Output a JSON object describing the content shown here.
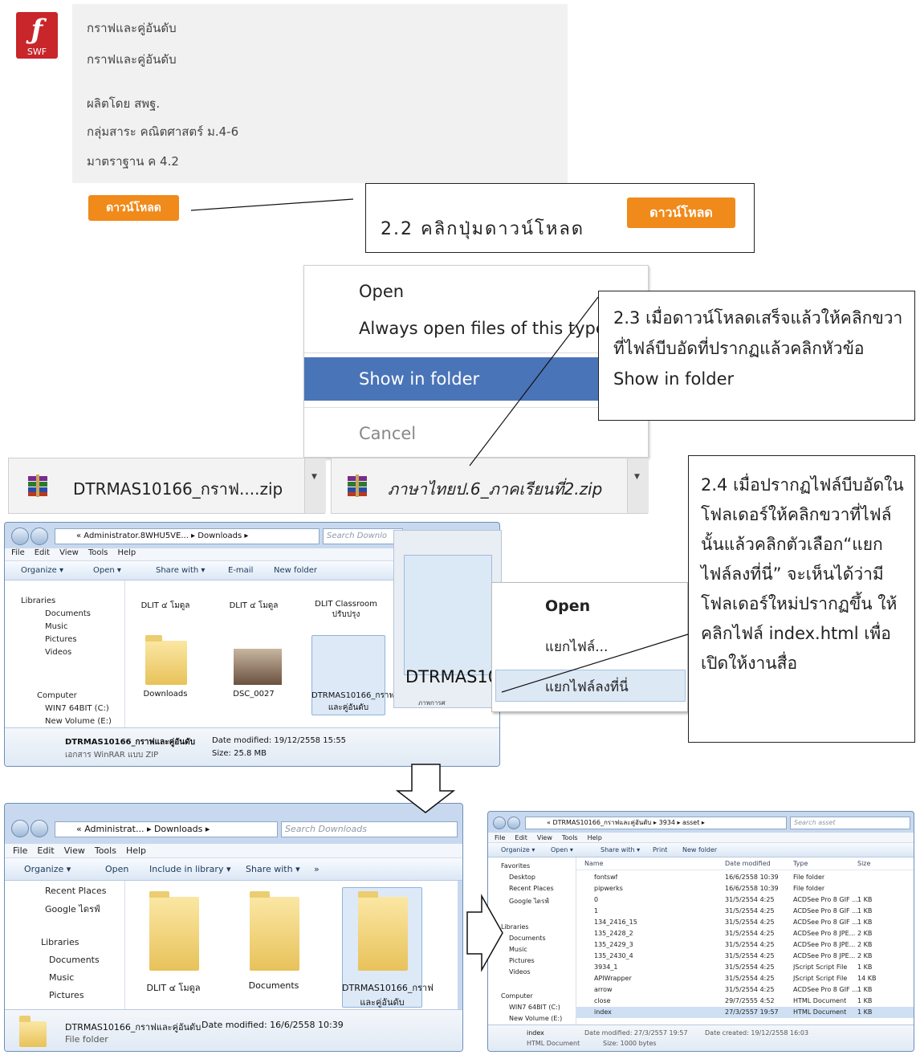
{
  "section1": {
    "icon_text": "SWF",
    "title": "กราฟและคู่อันดับ",
    "subtitle": "กราฟและคู่อันดับ",
    "producer": "ผลิตโดย สพฐ.",
    "subject": "กลุ่มสาระ คณิตศาสตร์ ม.4-6",
    "standard": "มาตราฐาน ค 4.2",
    "download_button": "ดาวน์โหลด",
    "callout_text": "2.2 คลิกปุ่มดาวน์โหลด",
    "callout_button": "ดาวน์โหลด"
  },
  "section2": {
    "menu_items": [
      "Open",
      "Always open files of this type",
      "Show in folder",
      "Cancel"
    ],
    "highlight_color": "#4a74b8",
    "callout_text": "2.3 เมื่อดาวน์โหลดเสร็จแล้วให้คลิกขวาที่ไฟล์บีบอัดที่ปรากฏแล้วคลิกหัวข้อ Show  in folder",
    "download1": "DTRMAS10166_กราฟ....zip",
    "download2": "ภาษาไทยป.6_ภาคเรียนที่2.zip"
  },
  "explorer1": {
    "address": "« Administrator.8WHU5VE... ▸ Downloads ▸",
    "search": "Search Downlo",
    "menubar": [
      "File",
      "Edit",
      "View",
      "Tools",
      "Help"
    ],
    "toolbar": [
      "Organize ▾",
      "Open ▾",
      "Share with ▾",
      "E-mail",
      "New folder"
    ],
    "nav": [
      "Libraries",
      "Documents",
      "Music",
      "Pictures",
      "Videos",
      "Computer",
      "WIN7 64BIT (C:)",
      "New Volume (E:)"
    ],
    "top_labels": [
      "DLIT ๔ โมดูล",
      "DLIT ๔ โมดูล",
      "DLIT Classroom ปรับปรุง"
    ],
    "items": [
      "Downloads",
      "DSC_0027",
      "DTRMAS10166_กราฟและคู่อันดับ"
    ],
    "details_name": "DTRMAS10166_กราฟและคู่อันดับ",
    "details_modified": "Date modified: 19/12/2558 15:55",
    "details_type": "เอกสาร WinRAR แบบ ZIP",
    "details_size": "Size: 25.8 MB"
  },
  "rar_popup": {
    "file_label": "DTRMAS10",
    "small_label": "ภาพการศ",
    "menu": [
      "Open",
      "แยกไฟล์...",
      "แยกไฟล์ลงที่นี่"
    ]
  },
  "callout24": "2.4 เมื่อปรากฏไฟล์บีบอัดในโฟลเดอร์ให้คลิกขวาที่ไฟล์นั้นแล้วคลิกตัวเลือก“แยกไฟล์ลงที่นี่” จะเห็นได้ว่ามีโฟลเดอร์ใหม่ปรากฏขึ้น ให้คลิกไฟล์ index.html เพื่อเปิดให้งานสื่อ",
  "explorer2": {
    "address": "« Administrat... ▸ Downloads ▸",
    "search": "Search Downloads",
    "menubar": [
      "File",
      "Edit",
      "View",
      "Tools",
      "Help"
    ],
    "toolbar": [
      "Organize ▾",
      "Open",
      "Include in library ▾",
      "Share with ▾",
      "»"
    ],
    "nav": [
      "Recent Places",
      "Google ไดรฟ์",
      "Libraries",
      "Documents",
      "Music",
      "Pictures"
    ],
    "items": [
      "DLIT ๔ โมดูล",
      "Documents",
      "DTRMAS10166_กราฟและคู่อันดับ"
    ],
    "details_name": "DTRMAS10166_กราฟและคู่อันดับ",
    "details_modified": "Date modified: 16/6/2558 10:39",
    "details_type": "File folder"
  },
  "explorer3": {
    "address": "« DTRMAS10166_กราฟและคู่อันดับ ▸ 3934 ▸ asset ▸",
    "search": "Search asset",
    "menubar": [
      "File",
      "Edit",
      "View",
      "Tools",
      "Help"
    ],
    "toolbar": [
      "Organize ▾",
      "Open ▾",
      "Share with ▾",
      "Print",
      "New folder"
    ],
    "nav": [
      "Favorites",
      "Desktop",
      "Recent Places",
      "Google ไดรฟ์",
      "Libraries",
      "Documents",
      "Music",
      "Pictures",
      "Videos",
      "Computer",
      "WIN7 64BIT (C:)",
      "New Volume (E:)"
    ],
    "columns": [
      "Name",
      "Date modified",
      "Type",
      "Size"
    ],
    "rows": [
      [
        "fontswf",
        "16/6/2558 10:39",
        "File folder",
        ""
      ],
      [
        "pipwerks",
        "16/6/2558 10:39",
        "File folder",
        ""
      ],
      [
        "0",
        "31/5/2554 4:25",
        "ACDSee Pro 8 GIF ...",
        "1 KB"
      ],
      [
        "1",
        "31/5/2554 4:25",
        "ACDSee Pro 8 GIF ...",
        "1 KB"
      ],
      [
        "134_2416_15",
        "31/5/2554 4:25",
        "ACDSee Pro 8 GIF ...",
        "1 KB"
      ],
      [
        "135_2428_2",
        "31/5/2554 4:25",
        "ACDSee Pro 8 JPE...",
        "2 KB"
      ],
      [
        "135_2429_3",
        "31/5/2554 4:25",
        "ACDSee Pro 8 JPE...",
        "2 KB"
      ],
      [
        "135_2430_4",
        "31/5/2554 4:25",
        "ACDSee Pro 8 JPE...",
        "2 KB"
      ],
      [
        "3934_1",
        "31/5/2554 4:25",
        "JScript Script File",
        "1 KB"
      ],
      [
        "APIWrapper",
        "31/5/2554 4:25",
        "JScript Script File",
        "14 KB"
      ],
      [
        "arrow",
        "31/5/2554 4:25",
        "ACDSee Pro 8 GIF ...",
        "1 KB"
      ],
      [
        "close",
        "29/7/2555 4:52",
        "HTML Document",
        "1 KB"
      ],
      [
        "index",
        "27/3/2557 19:57",
        "HTML Document",
        "1 KB"
      ]
    ],
    "details_name": "index",
    "details_type": "HTML Document",
    "details_modified": "Date modified: 27/3/2557 19:57",
    "details_created": "Date created: 19/12/2558 16:03",
    "details_size": "Size: 1000 bytes"
  }
}
